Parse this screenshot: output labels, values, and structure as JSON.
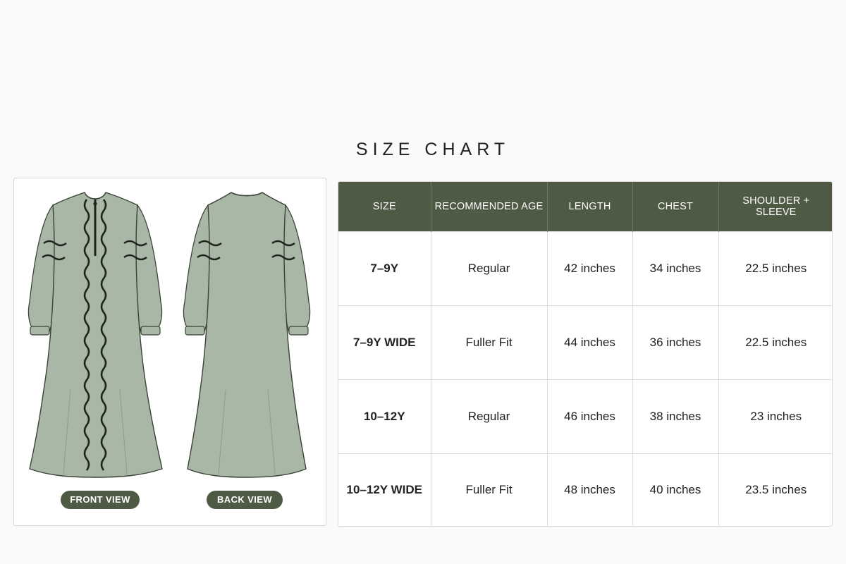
{
  "title": "SIZE CHART",
  "illustration": {
    "front_label": "FRONT VIEW",
    "back_label": "BACK VIEW",
    "garment_color": "#a9b7a6",
    "trim_color": "#1e241c"
  },
  "table": {
    "header_color": "#4f5a45",
    "headers": [
      "SIZE",
      "RECOMMENDED AGE",
      "LENGTH",
      "CHEST",
      "SHOULDER + SLEEVE"
    ],
    "rows": [
      [
        "7–9Y",
        "Regular",
        "42 inches",
        "34 inches",
        "22.5 inches"
      ],
      [
        "7–9Y WIDE",
        "Fuller Fit",
        "44 inches",
        "36 inches",
        "22.5 inches"
      ],
      [
        "10–12Y",
        "Regular",
        "46 inches",
        "38 inches",
        "23 inches"
      ],
      [
        "10–12Y WIDE",
        "Fuller Fit",
        "48 inches",
        "40 inches",
        "23.5 inches"
      ]
    ]
  }
}
